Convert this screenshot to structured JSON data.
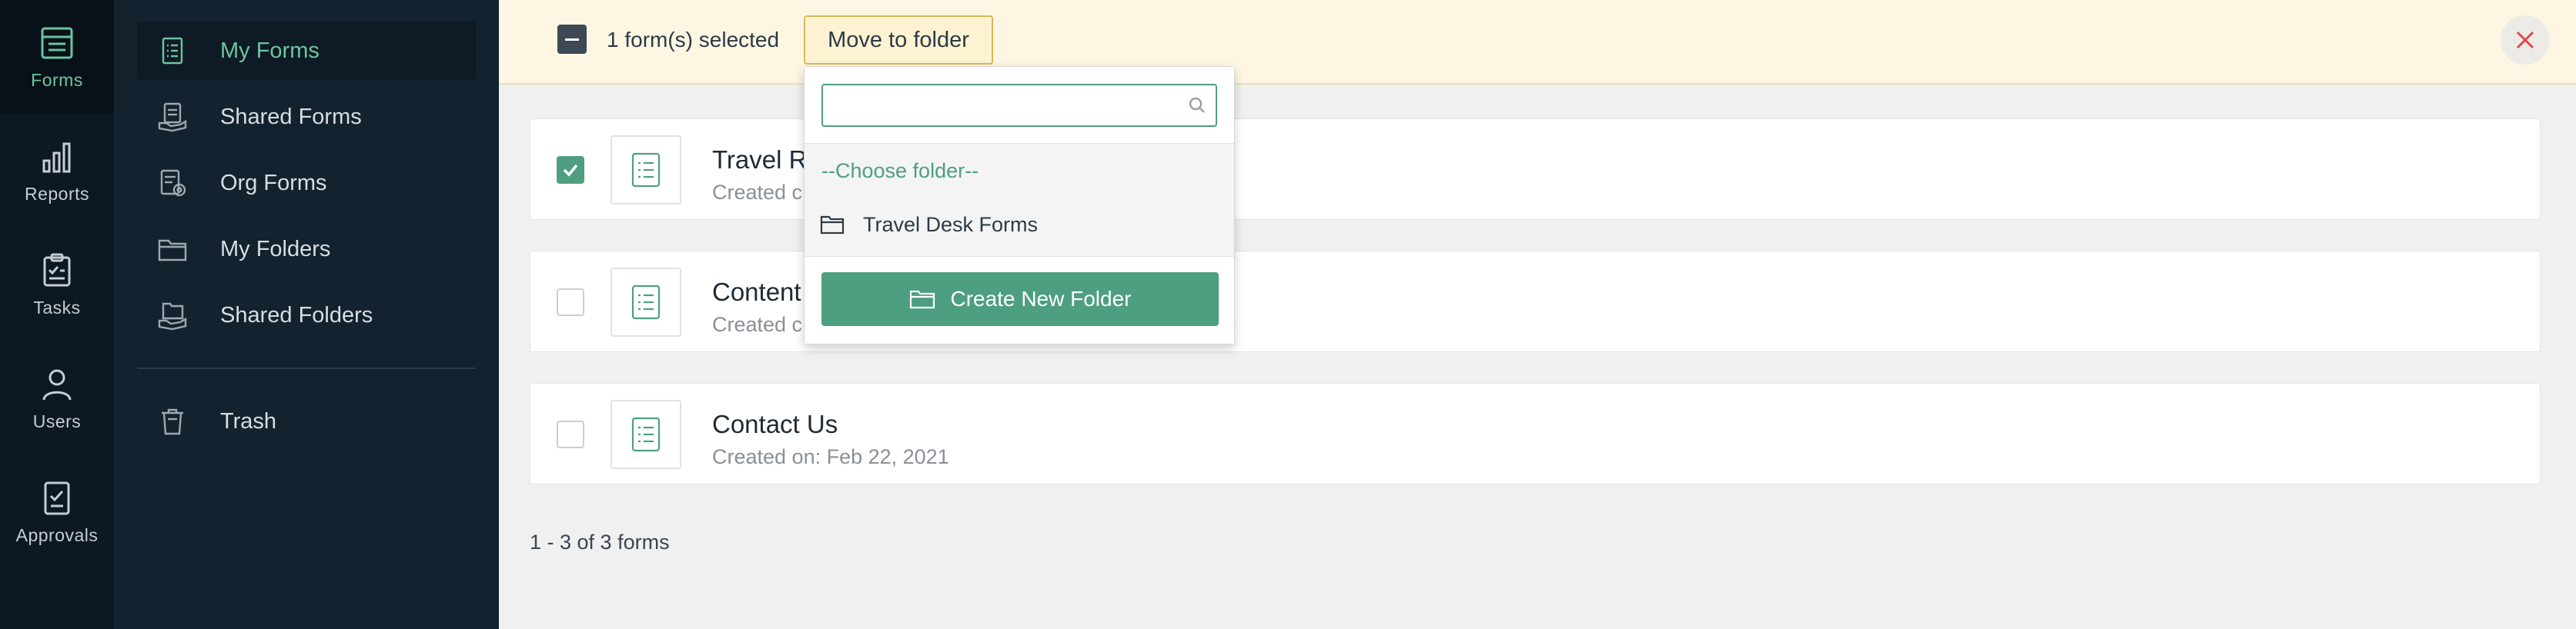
{
  "rail": {
    "items": [
      {
        "label": "Forms",
        "icon": "forms-icon",
        "active": true
      },
      {
        "label": "Reports",
        "icon": "bar-chart-icon"
      },
      {
        "label": "Tasks",
        "icon": "clipboard-icon"
      },
      {
        "label": "Users",
        "icon": "user-icon"
      },
      {
        "label": "Approvals",
        "icon": "approval-icon"
      }
    ]
  },
  "sidebar": {
    "items": [
      {
        "label": "My Forms",
        "icon": "form-doc-icon",
        "active": true
      },
      {
        "label": "Shared Forms",
        "icon": "shared-form-icon"
      },
      {
        "label": "Org Forms",
        "icon": "org-form-icon"
      },
      {
        "label": "My Folders",
        "icon": "folder-icon"
      },
      {
        "label": "Shared Folders",
        "icon": "shared-folder-icon"
      }
    ],
    "trash_label": "Trash"
  },
  "topbar": {
    "selected_text": "1 form(s) selected",
    "move_label": "Move to folder"
  },
  "forms": [
    {
      "title": "Travel R",
      "date": "Created c",
      "checked": true
    },
    {
      "title": "Content",
      "date": "Created c",
      "checked": false
    },
    {
      "title": "Contact Us",
      "date": "Created on: Feb 22, 2021",
      "checked": false
    }
  ],
  "pager": "1 - 3 of 3 forms",
  "dropdown": {
    "search_value": "",
    "choose_label": "--Choose folder--",
    "folder_label": "Travel Desk Forms",
    "create_label": "Create New Folder"
  },
  "colors": {
    "accent": "#4e9f80",
    "rail_bg": "#0c1822",
    "sidebar_bg": "#13222f",
    "topbar_bg": "#fdf6e2",
    "close_red": "#e04848"
  }
}
